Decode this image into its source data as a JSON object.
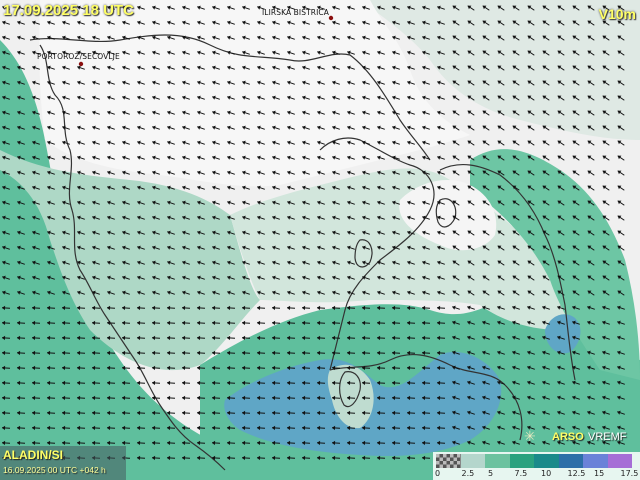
{
  "header": {
    "valid_time": "17.09.2025 18 UTC",
    "variable_code": "V10m"
  },
  "places": [
    {
      "name": "ILIRSKA BISTRICA"
    },
    {
      "name": "PORTOROŽ/SEČOVLJE"
    }
  ],
  "model": {
    "name": "ALADIN/SI",
    "run": "16.09.2025 00 UTC +042 h"
  },
  "brand": {
    "icon": "satellite-icon",
    "arso": "ARSO",
    "vremf": "VREMF"
  },
  "legend": {
    "colors": [
      "#ffffff",
      "#b4d6cc",
      "#6cc29f",
      "#2aa27f",
      "#1a8a8a",
      "#2c6fa8",
      "#6a82d8",
      "#a66ed6"
    ],
    "labels": [
      "0",
      "2.5",
      "5",
      "7.5",
      "10",
      "12.5",
      "15",
      "17.5"
    ],
    "unit_note": ""
  },
  "map_colors": {
    "land_bg": "#f2f2f2",
    "sea_green": "#5fbf9d",
    "pale_green": "#9ed1bd",
    "light_green": "#cfe3da",
    "blue_zone": "#5ea9c4",
    "border": "#333333"
  }
}
